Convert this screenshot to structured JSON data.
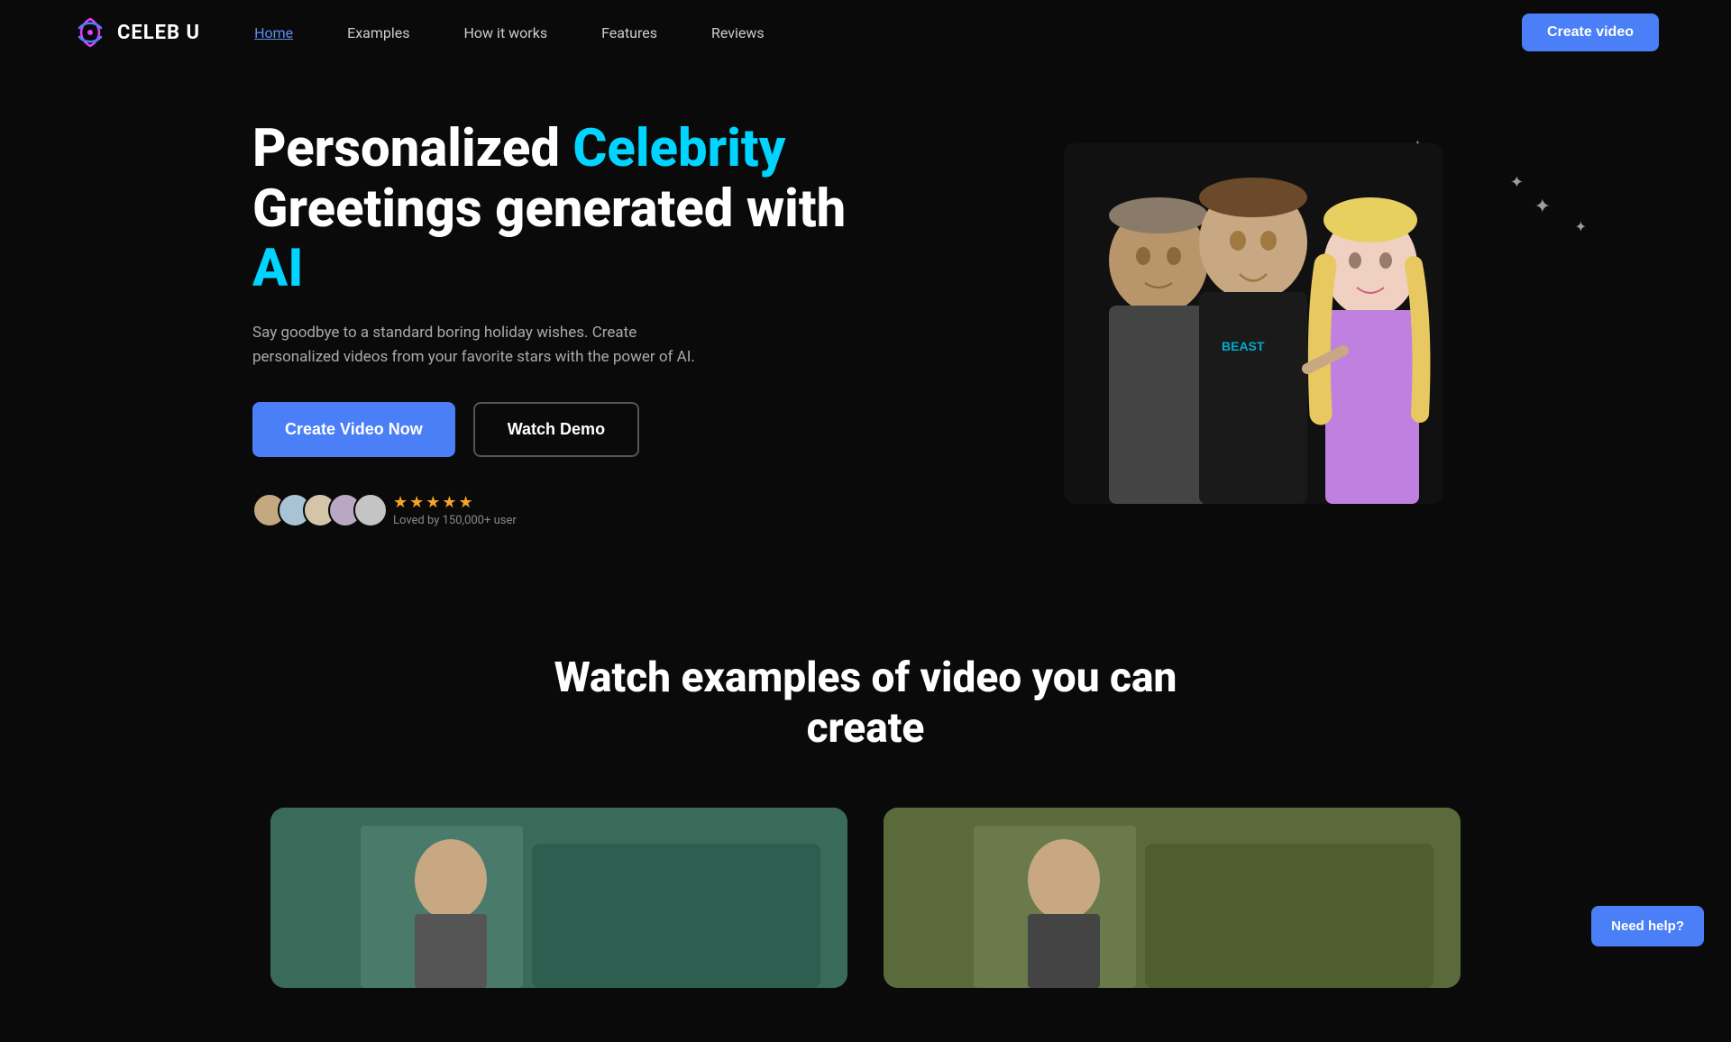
{
  "brand": {
    "logo_text": "CELEB U",
    "logo_icon": "★"
  },
  "nav": {
    "links": [
      {
        "label": "Home",
        "active": true
      },
      {
        "label": "Examples",
        "active": false
      },
      {
        "label": "How it works",
        "active": false
      },
      {
        "label": "Features",
        "active": false
      },
      {
        "label": "Reviews",
        "active": false
      }
    ],
    "cta_label": "Create video"
  },
  "hero": {
    "title_part1": "Personalized ",
    "title_highlight": "Celebrity",
    "title_part2": "Greetings generated with ",
    "title_ai": "AI",
    "subtitle": "Say goodbye to a standard boring holiday wishes. Create personalized videos from your favorite stars with the power of AI.",
    "btn_primary": "Create Video Now",
    "btn_secondary": "Watch Demo",
    "social_proof": {
      "loved_text": "Loved by 150,000+ user",
      "stars": "★★★★★"
    }
  },
  "examples_section": {
    "title_line1": "Watch examples of video you can",
    "title_line2": "create"
  },
  "help_button": {
    "label": "Need help?"
  },
  "colors": {
    "accent_blue": "#4a7ff7",
    "cyan": "#00d4ff",
    "stars_gold": "#f5a623",
    "bg": "#0a0a0a"
  }
}
